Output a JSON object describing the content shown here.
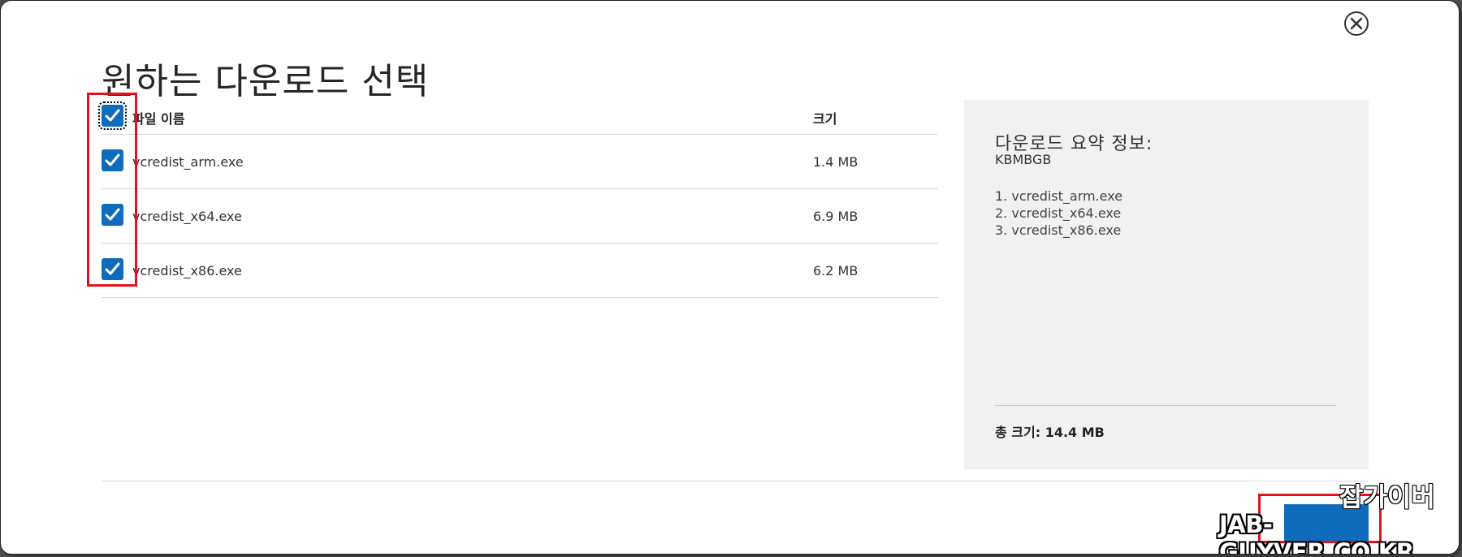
{
  "dialog": {
    "title": "원하는 다운로드 선택"
  },
  "table": {
    "header": {
      "name_label": "파일 이름",
      "size_label": "크기",
      "select_all_checked": true
    },
    "rows": [
      {
        "name": "vcredist_arm.exe",
        "size": "1.4 MB",
        "checked": true
      },
      {
        "name": "vcredist_x64.exe",
        "size": "6.9 MB",
        "checked": true
      },
      {
        "name": "vcredist_x86.exe",
        "size": "6.2 MB",
        "checked": true
      }
    ]
  },
  "summary": {
    "title": "다운로드 요약 정보:",
    "package_id": "KBMBGB",
    "items": [
      "1. vcredist_arm.exe",
      "2. vcredist_x64.exe",
      "3. vcredist_x86.exe"
    ],
    "total": "총 크기: 14.4 MB"
  },
  "watermark": {
    "korean": "잡가이버",
    "english": "JAB-GUYVER.CO.KR"
  },
  "colors": {
    "accent": "#0f6cbd",
    "highlight": "#e1121e",
    "panel": "#f1f1f1"
  },
  "icons": {
    "close": "close-circle-icon",
    "checkbox": "checkmark-icon"
  }
}
